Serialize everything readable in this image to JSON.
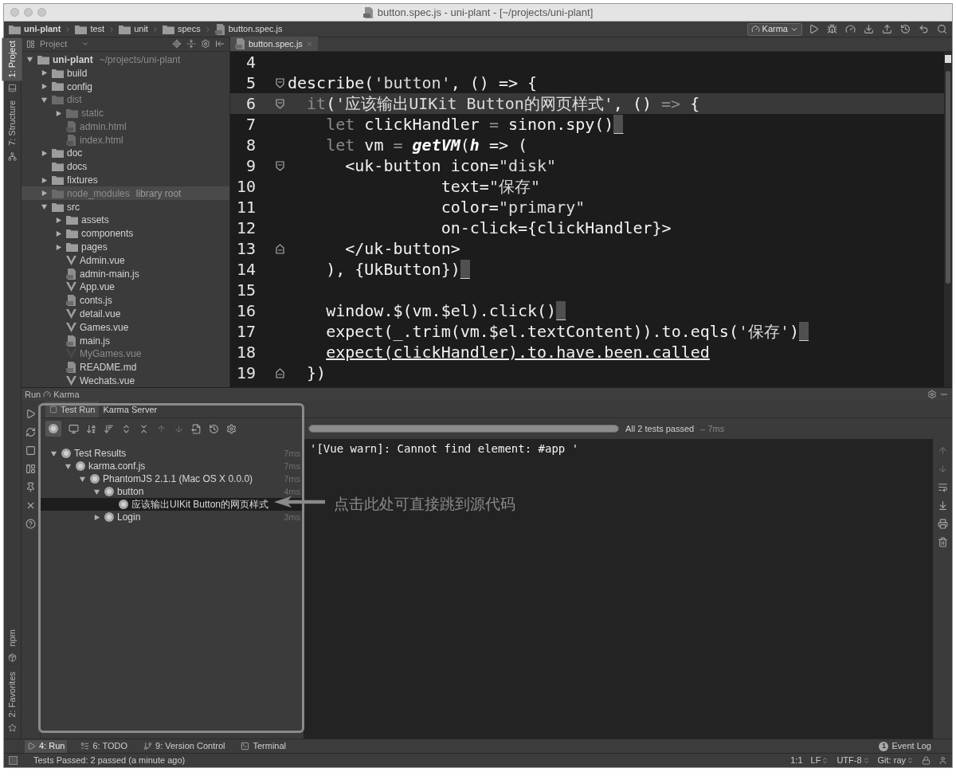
{
  "window": {
    "title": "button.spec.js - uni-plant - [~/projects/uni-plant]"
  },
  "breadcrumbs": [
    {
      "label": "uni-plant",
      "kind": "folder"
    },
    {
      "label": "test",
      "kind": "folder"
    },
    {
      "label": "unit",
      "kind": "folder"
    },
    {
      "label": "specs",
      "kind": "folder"
    },
    {
      "label": "button.spec.js",
      "kind": "file"
    }
  ],
  "run_config": {
    "label": "Karma"
  },
  "tool_strip": {
    "top": [
      {
        "label": "1: Project",
        "selected": true
      },
      {
        "label": "7: Structure",
        "selected": false
      }
    ],
    "bottom": [
      {
        "label": "npm",
        "selected": false
      },
      {
        "label": "2: Favorites",
        "selected": false
      }
    ]
  },
  "project": {
    "title": "Project",
    "root": {
      "name": "uni-plant",
      "path": "~/projects/uni-plant",
      "kind": "folder",
      "expanded": true,
      "excluded": false,
      "selected": false,
      "children": [
        {
          "name": "build",
          "kind": "folder",
          "expanded": false,
          "excluded": false,
          "selected": false
        },
        {
          "name": "config",
          "kind": "folder",
          "expanded": false,
          "excluded": false,
          "selected": false
        },
        {
          "name": "dist",
          "kind": "folder",
          "expanded": true,
          "excluded": true,
          "selected": false,
          "children": [
            {
              "name": "static",
              "kind": "folder",
              "expanded": false,
              "excluded": true,
              "selected": false
            },
            {
              "name": "admin.html",
              "kind": "file",
              "excluded": true,
              "selected": false
            },
            {
              "name": "index.html",
              "kind": "file",
              "excluded": true,
              "selected": false
            }
          ]
        },
        {
          "name": "doc",
          "kind": "folder",
          "expanded": false,
          "excluded": false,
          "selected": false
        },
        {
          "name": "docs",
          "kind": "folder",
          "excluded": false,
          "selected": false
        },
        {
          "name": "fixtures",
          "kind": "folder",
          "expanded": false,
          "excluded": false,
          "selected": false
        },
        {
          "name": "node_modules",
          "suffix": "library root",
          "kind": "folder",
          "expanded": false,
          "excluded": true,
          "selected": true
        },
        {
          "name": "src",
          "kind": "folder",
          "expanded": true,
          "excluded": false,
          "selected": false,
          "children": [
            {
              "name": "assets",
              "kind": "folder",
              "expanded": false,
              "excluded": false,
              "selected": false
            },
            {
              "name": "components",
              "kind": "folder",
              "expanded": false,
              "excluded": false,
              "selected": false
            },
            {
              "name": "pages",
              "kind": "folder",
              "expanded": false,
              "excluded": false,
              "selected": false
            },
            {
              "name": "Admin.vue",
              "kind": "vue",
              "excluded": false,
              "selected": false
            },
            {
              "name": "admin-main.js",
              "kind": "file",
              "excluded": false,
              "selected": false
            },
            {
              "name": "App.vue",
              "kind": "vue",
              "excluded": false,
              "selected": false
            },
            {
              "name": "conts.js",
              "kind": "file",
              "excluded": false,
              "selected": false
            },
            {
              "name": "detail.vue",
              "kind": "vue",
              "excluded": false,
              "selected": false
            },
            {
              "name": "Games.vue",
              "kind": "vue",
              "excluded": false,
              "selected": false
            },
            {
              "name": "main.js",
              "kind": "file",
              "excluded": false,
              "selected": false
            },
            {
              "name": "MyGames.vue",
              "kind": "vue",
              "excluded": true,
              "selected": false
            },
            {
              "name": "README.md",
              "kind": "file",
              "excluded": false,
              "selected": false
            },
            {
              "name": "Wechats.vue",
              "kind": "vue",
              "excluded": false,
              "selected": false
            }
          ]
        }
      ]
    }
  },
  "editor": {
    "tabs": [
      {
        "label": "button.spec.js",
        "selected": true
      }
    ],
    "lines": [
      {
        "number": "4",
        "kind": "plain",
        "current": false
      },
      {
        "number": "5",
        "kind": "fold-start",
        "current": false,
        "segments": [
          {
            "text": "describe(",
            "kind": "code"
          },
          {
            "text": "'button'",
            "kind": "string"
          },
          {
            "text": ", () => {",
            "kind": "code"
          }
        ]
      },
      {
        "number": "6",
        "kind": "fold-start",
        "current": true,
        "segments": [
          {
            "text": "  it",
            "kind": "dim"
          },
          {
            "text": "(",
            "kind": "code"
          },
          {
            "text": "'应该输出UIKit Button的网页样式'",
            "kind": "string"
          },
          {
            "text": ", () ",
            "kind": "code"
          },
          {
            "text": "=>",
            "kind": "dim"
          },
          {
            "text": " {",
            "kind": "code"
          }
        ]
      },
      {
        "number": "7",
        "kind": "plain",
        "current": false,
        "segments": [
          {
            "text": "    let",
            "kind": "dim"
          },
          {
            "text": " clickHandler ",
            "kind": "code"
          },
          {
            "text": "=",
            "kind": "dim"
          },
          {
            "text": " sinon.spy()",
            "kind": "code"
          },
          {
            "text": "_",
            "kind": "caret"
          }
        ]
      },
      {
        "number": "8",
        "kind": "plain",
        "current": false,
        "segments": [
          {
            "text": "    let",
            "kind": "dim"
          },
          {
            "text": " vm ",
            "kind": "code"
          },
          {
            "text": "= ",
            "kind": "dim"
          },
          {
            "text": "getVM",
            "kind": "italic"
          },
          {
            "text": "(",
            "kind": "code"
          },
          {
            "text": "h",
            "kind": "italic"
          },
          {
            "text": " => (",
            "kind": "code"
          }
        ]
      },
      {
        "number": "9",
        "kind": "fold-start",
        "current": false,
        "segments": [
          {
            "text": "      <uk-button icon=",
            "kind": "code"
          },
          {
            "text": "\"disk\"",
            "kind": "string"
          }
        ]
      },
      {
        "number": "10",
        "kind": "plain",
        "current": false,
        "segments": [
          {
            "text": "                text=",
            "kind": "code"
          },
          {
            "text": "\"保存\"",
            "kind": "string"
          }
        ]
      },
      {
        "number": "11",
        "kind": "plain",
        "current": false,
        "segments": [
          {
            "text": "                color=",
            "kind": "code"
          },
          {
            "text": "\"primary\"",
            "kind": "string"
          }
        ]
      },
      {
        "number": "12",
        "kind": "plain",
        "current": false,
        "segments": [
          {
            "text": "                on-click={clickHandler}>",
            "kind": "code"
          }
        ]
      },
      {
        "number": "13",
        "kind": "fold-end",
        "current": false,
        "segments": [
          {
            "text": "      </uk-button>",
            "kind": "code"
          }
        ]
      },
      {
        "number": "14",
        "kind": "plain",
        "current": false,
        "segments": [
          {
            "text": "    ), {UkButton})",
            "kind": "code"
          },
          {
            "text": "_",
            "kind": "caret"
          }
        ]
      },
      {
        "number": "15",
        "kind": "plain",
        "current": false
      },
      {
        "number": "16",
        "kind": "plain",
        "current": false,
        "segments": [
          {
            "text": "    window.$(vm.$el).click()",
            "kind": "code"
          },
          {
            "text": "_",
            "kind": "caret"
          }
        ]
      },
      {
        "number": "17",
        "kind": "plain",
        "current": false,
        "segments": [
          {
            "text": "    expect(_.trim(vm.$el.textContent)).to.eqls(",
            "kind": "code"
          },
          {
            "text": "'保存'",
            "kind": "string"
          },
          {
            "text": ")",
            "kind": "code"
          },
          {
            "text": "_",
            "kind": "caret"
          }
        ]
      },
      {
        "number": "18",
        "kind": "plain",
        "current": false,
        "segments": [
          {
            "text": "    expect(clickHandler).to.have.been.called",
            "kind": "link"
          }
        ]
      },
      {
        "number": "19",
        "kind": "fold-end",
        "current": false,
        "segments": [
          {
            "text": "  })",
            "kind": "code"
          }
        ]
      }
    ]
  },
  "run": {
    "title": "Run",
    "config": "Karma",
    "tabs": [
      {
        "label": "Test Run",
        "selected": true
      },
      {
        "label": "Karma Server",
        "selected": false
      }
    ],
    "tests": [
      {
        "name": "Test Results",
        "time": "7ms",
        "expanded": true,
        "selected": false,
        "children": [
          {
            "name": "karma.conf.js",
            "time": "7ms",
            "expanded": true,
            "selected": false,
            "children": [
              {
                "name": "PhantomJS 2.1.1 (Mac OS X 0.0.0)",
                "time": "7ms",
                "expanded": true,
                "selected": false,
                "children": [
                  {
                    "name": "button",
                    "time": "4ms",
                    "expanded": true,
                    "selected": false,
                    "children": [
                      {
                        "name": "应该输出UIKit Button的网页样式",
                        "selected": true
                      }
                    ]
                  },
                  {
                    "name": "Login",
                    "time": "3ms",
                    "expanded": false,
                    "selected": false
                  }
                ]
              }
            ]
          }
        ]
      }
    ],
    "progress": {
      "level": 1,
      "summary": "All 2 tests passed",
      "time": "– 7ms"
    },
    "console": [
      "'[Vue warn]: Cannot find element: #app '"
    ],
    "annotation": {
      "text": "点击此处可直接跳到源代码"
    }
  },
  "bottom_tabs": [
    {
      "label": "4: Run",
      "kind": "run",
      "selected": true
    },
    {
      "label": "6: TODO",
      "kind": "todo",
      "selected": false
    },
    {
      "label": "9: Version Control",
      "kind": "vcs",
      "selected": false
    },
    {
      "label": "Terminal",
      "kind": "terminal",
      "selected": false
    }
  ],
  "event_log": {
    "label": "Event Log",
    "count": "1"
  },
  "status_bar": {
    "message": "Tests Passed: 2 passed (a minute ago)",
    "items": [
      {
        "label": "1:1",
        "dropdown": false
      },
      {
        "label": "LF",
        "dropdown": true
      },
      {
        "label": "UTF-8",
        "dropdown": true
      },
      {
        "label": "Git: ray",
        "dropdown": true
      }
    ]
  }
}
